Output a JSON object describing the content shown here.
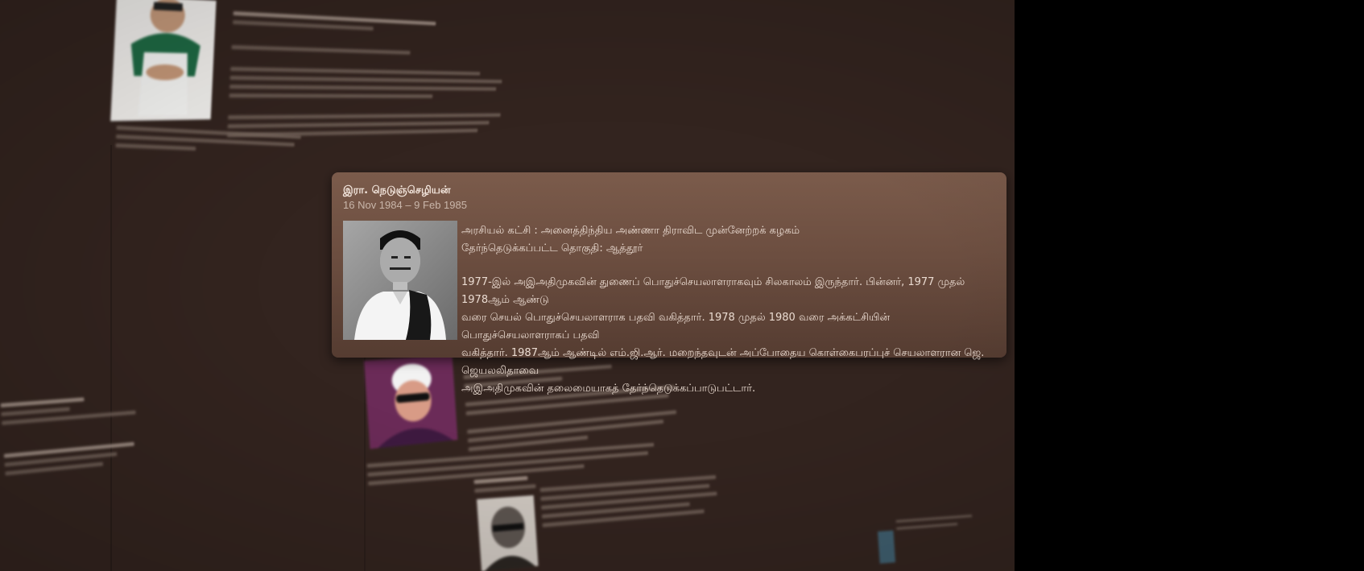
{
  "card": {
    "name": "இரா. நெடுஞ்செழியன்",
    "dates": "16 Nov 1984 – 9 Feb 1985",
    "party_line": "அரசியல் கட்சி : அனைத்திந்திய அண்ணா திராவிட முன்னேற்றக் கழகம்",
    "constituency_line": "தேர்ந்தெடுக்கப்பட்ட தொகுதி: ஆத்தூர்",
    "bio_lines": [
      "1977-இல் அஇஅதிமுகவின் துணைப் பொதுச்செயலாளராகவும் சிலகாலம் இருந்தார். பின்னர், 1977 முதல் 1978ஆம் ஆண்டு",
      "வரை செயல் பொதுச்செயலாளராக பதவி வகித்தார். 1978 முதல் 1980 வரை அக்கட்சியின் பொதுச்செயலாளராகப் பதவி",
      "வகித்தார். 1987ஆம் ஆண்டில் எம்.ஜி.ஆர். மறைந்தவுடன் அப்போதைய கொள்கைபரப்புச் செயலாளரான ஜெ. ஜெயலலிதாவை",
      "அஇஅதிமுகவின் தலைமையாகத் தேர்ந்தெடுக்கப்பாடுபட்டார்."
    ]
  },
  "colors": {
    "background": "#33241f",
    "card_top": "#7b5b4b",
    "card_bottom": "#553c31",
    "outside": "#000000"
  }
}
